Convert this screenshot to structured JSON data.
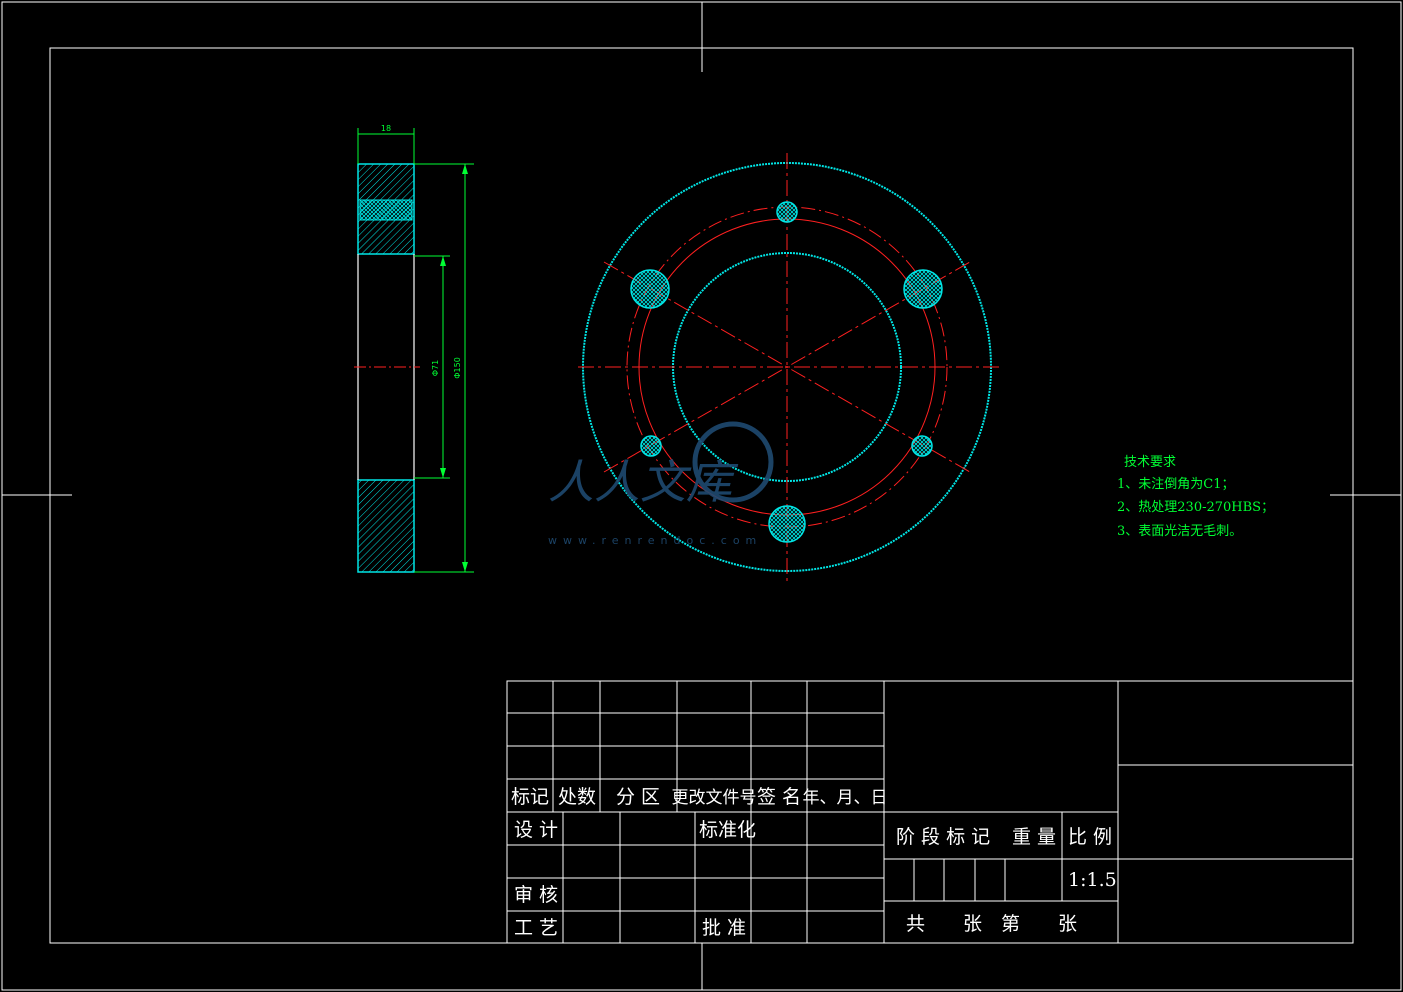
{
  "drawing": {
    "watermark": {
      "brand": "人人文库",
      "site": "www.renrendoc.com"
    },
    "side_view": {
      "dim_width": "18",
      "dim_inner": "Φ71",
      "dim_outer": "Φ150"
    },
    "tech_requirements": {
      "title": "技术要求",
      "items": [
        "1、未注倒角为C1；",
        "2、热处理230-270HBS；",
        "3、表面光洁无毛刺。"
      ]
    },
    "title_block": {
      "revision_headers": [
        "标记",
        "处数",
        "分 区",
        "更改文件号",
        "签 名",
        "年、月、日"
      ],
      "design": "设 计",
      "standardization": "标准化",
      "review": "审 核",
      "process": "工 艺",
      "approve": "批 准",
      "stage_mark": "阶 段 标 记",
      "weight": "重 量",
      "scale_label": "比 例",
      "scale_value": "1:1.5",
      "sheets": "共　　张　第　　张"
    },
    "colors": {
      "border": "#ffffff",
      "outline": "#00e6e6",
      "center_line": "#ff2020",
      "dimension": "#00ff33"
    }
  }
}
